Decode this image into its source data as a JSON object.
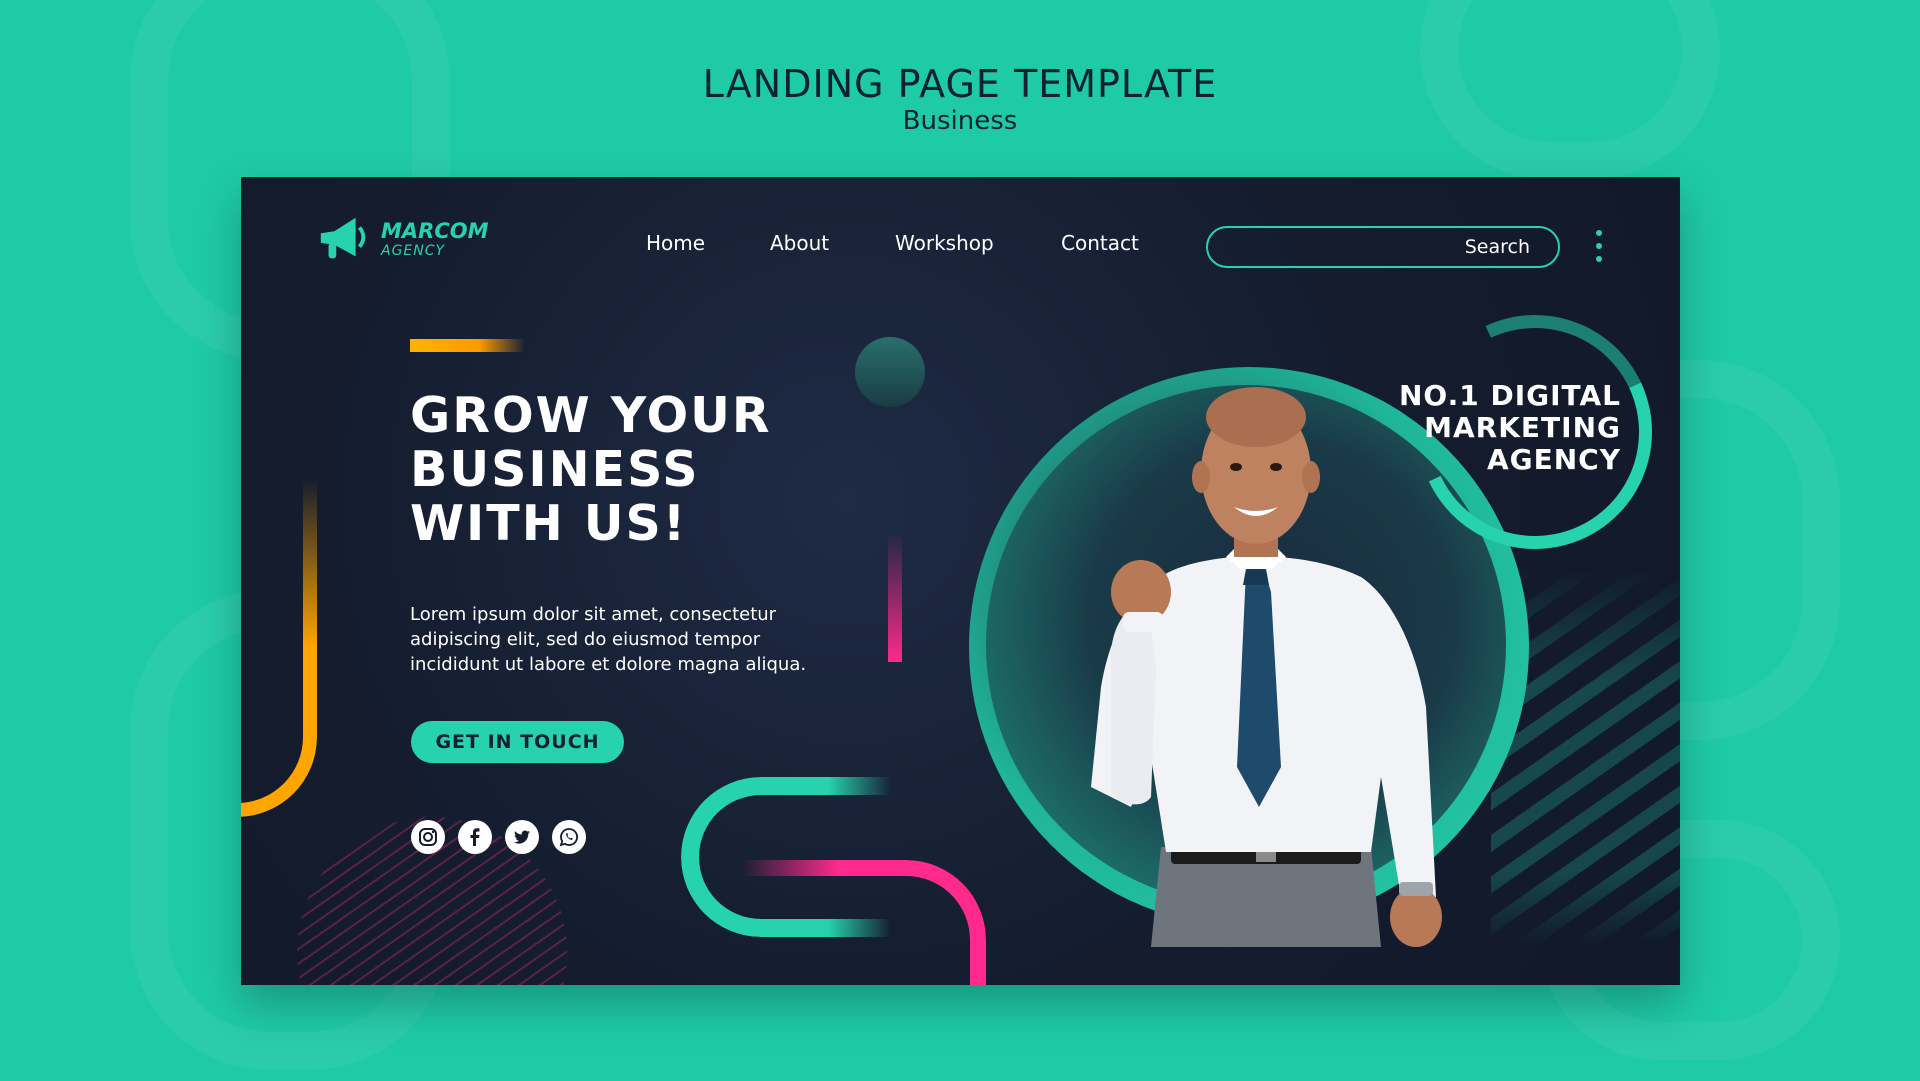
{
  "header": {
    "title": "LANDING PAGE TEMPLATE",
    "subtitle": "Business"
  },
  "logo": {
    "name": "MARCOM",
    "sub": "AGENCY",
    "icon": "megaphone-icon"
  },
  "nav": {
    "items": [
      {
        "label": "Home"
      },
      {
        "label": "About"
      },
      {
        "label": "Workshop"
      },
      {
        "label": "Contact"
      }
    ]
  },
  "search": {
    "label": "Search",
    "value": ""
  },
  "hero": {
    "headline": "GROW YOUR\nBUSINESS\nWITH US!",
    "body": "Lorem ipsum dolor sit amet, consectetur adipiscing elit, sed do eiusmod tempor incididunt ut labore et dolore magna aliqua.",
    "cta_label": "GET IN TOUCH",
    "tagline": "NO.1 DIGITAL\nMARKETING\nAGENCY"
  },
  "socials": [
    {
      "icon": "instagram-icon"
    },
    {
      "icon": "facebook-icon"
    },
    {
      "icon": "twitter-icon"
    },
    {
      "icon": "whatsapp-icon"
    }
  ],
  "colors": {
    "background": "#1fcaa8",
    "card": "#141c2e",
    "accent_teal": "#27d2ae",
    "accent_pink": "#ff2a8c",
    "accent_orange": "#ffa500"
  }
}
